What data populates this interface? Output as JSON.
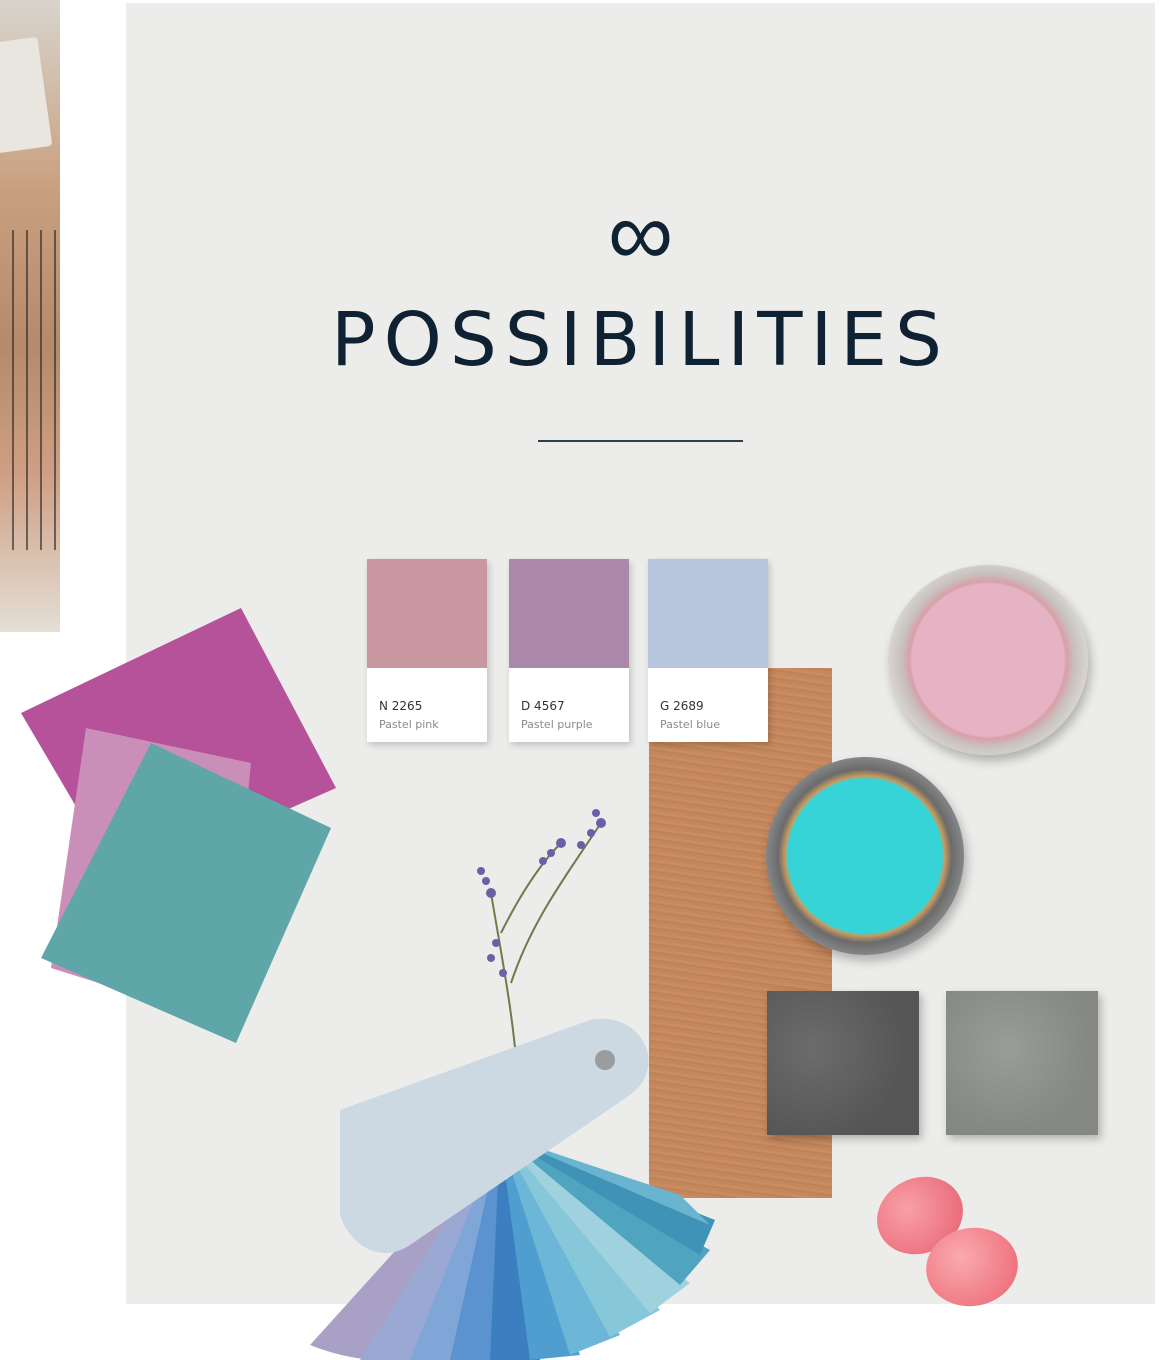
{
  "page": {
    "icon": "infinity-icon",
    "icon_glyph": "∞",
    "title": "POSSIBILITIES"
  },
  "cards": [
    {
      "code": "N 2265",
      "name": "Pastel pink",
      "color": "#c9979f"
    },
    {
      "code": "D 4567",
      "name": "Pastel purple",
      "color": "#ab88a9"
    },
    {
      "code": "G 2689",
      "name": "Pastel blue",
      "color": "#b7c6dd"
    }
  ],
  "colors": {
    "background_panel": "#ececea",
    "title": "#0f2233",
    "fabric_magenta": "#b5529a",
    "fabric_lilac": "#c98fb8",
    "fabric_teal": "#5fa6a8",
    "wood": "#c4865b",
    "paint_pink": "#e5b3c3",
    "paint_teal": "#36d4d6",
    "stone_dark": "#5e5e5e",
    "stone_light": "#8f918f",
    "macaron": "#ef7a86"
  }
}
